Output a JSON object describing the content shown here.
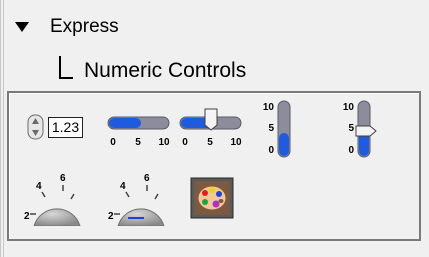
{
  "tree": {
    "category_label": "Express",
    "subcategory_label": "Numeric Controls"
  },
  "palette": {
    "numeric_control": {
      "value_text": "1.23"
    },
    "horizontal_fill_slider": {
      "ticks": [
        "0",
        "5",
        "10"
      ],
      "level": 0.55
    },
    "horizontal_pointer_slider": {
      "ticks": [
        "0",
        "5",
        "10"
      ],
      "level": 0.55
    },
    "vertical_fill_slider": {
      "ticks": [
        "10",
        "5",
        "0"
      ],
      "level": 0.4
    },
    "vertical_pointer_slider": {
      "ticks": [
        "10",
        "5",
        "0"
      ],
      "level": 0.5
    },
    "knob": {
      "ticks": [
        "2",
        "4",
        "6"
      ]
    },
    "dial": {
      "ticks": [
        "2",
        "4",
        "6"
      ]
    }
  },
  "colors": {
    "fill_blue": "#1f5bdc",
    "track_gray": "#8c8c9c",
    "knob_gray": "#a8a8a8"
  },
  "icons": [
    "expand-caret-icon",
    "tree-branch-icon",
    "color-palette-icon"
  ]
}
